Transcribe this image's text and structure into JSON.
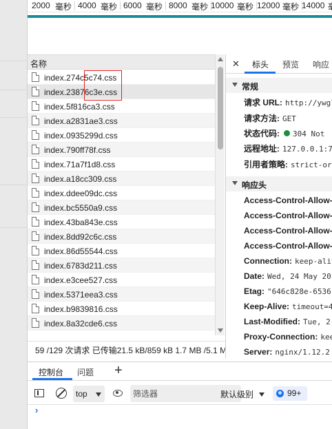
{
  "timeline": {
    "ticks": [
      "2000",
      "毫秒",
      "4000",
      "毫秒",
      "6000",
      "毫秒",
      "8000",
      "毫秒",
      "10000",
      "毫秒",
      "12000",
      "毫秒",
      "14000",
      "毫秒"
    ]
  },
  "request_list": {
    "header": "名称",
    "rows": [
      "index.274c5c74.css",
      "index.23876c3e.css",
      "index.5f816ca3.css",
      "index.a2831ae3.css",
      "index.0935299d.css",
      "index.790ff78f.css",
      "index.71a7f1d8.css",
      "index.a18cc309.css",
      "index.ddee09dc.css",
      "index.bc5550a9.css",
      "index.43ba843e.css",
      "index.8dd92c6c.css",
      "index.86d55544.css",
      "index.6783d211.css",
      "index.e3cee527.css",
      "index.5371eea3.css",
      "index.b9839816.css",
      "index.8a32cde6.css"
    ]
  },
  "status_bar": {
    "text": "59 /129 次请求   已传输21.5 kB/859 kB   1.7 MB /5.1 M"
  },
  "details": {
    "close_icon": "✕",
    "tabs": [
      "标头",
      "预览",
      "响应"
    ],
    "general": {
      "title": "常规",
      "rows": [
        {
          "k": "请求 URL:",
          "v": "http://ywgl"
        },
        {
          "k": "请求方法:",
          "v": "GET"
        },
        {
          "k": "状态代码:",
          "v": "304 Not"
        },
        {
          "k": "远程地址:",
          "v": "127.0.0.1:7"
        },
        {
          "k": "引用者策略:",
          "v": "strict-or"
        }
      ]
    },
    "response_headers": {
      "title": "响应头",
      "rows": [
        {
          "k": "Access-Control-Allow-C",
          "v": ""
        },
        {
          "k": "Access-Control-Allow-H",
          "v": ""
        },
        {
          "k": "Access-Control-Allow-M",
          "v": ""
        },
        {
          "k": "Access-Control-Allow-O",
          "v": ""
        },
        {
          "k": "Connection:",
          "v": "keep-aliv"
        },
        {
          "k": "Date:",
          "v": "Wed, 24 May 20"
        },
        {
          "k": "Etag:",
          "v": "\"646c828e-6536"
        },
        {
          "k": "Keep-Alive:",
          "v": "timeout=4"
        },
        {
          "k": "Last-Modified:",
          "v": "Tue, 2"
        },
        {
          "k": "Proxy-Connection:",
          "v": "kee"
        },
        {
          "k": "Server:",
          "v": "nginx/1.12.2"
        }
      ]
    }
  },
  "drawer": {
    "tabs": [
      "控制台",
      "问题"
    ],
    "plus": "+"
  },
  "console_toolbar": {
    "context": "top",
    "filter_placeholder": "筛选器",
    "level": "默认级别",
    "issues_count": "99+"
  },
  "console": {
    "prompt": "›"
  },
  "colors": {
    "accent": "#1a73e8",
    "highlight_box": "#e21c1c",
    "status_ok": "#1e8e3e"
  }
}
